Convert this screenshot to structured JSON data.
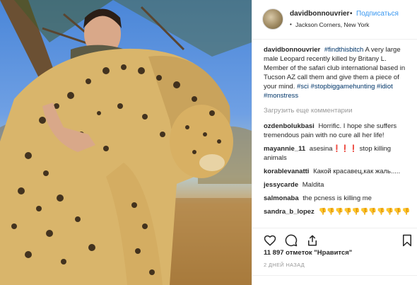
{
  "header": {
    "username": "davidbonnouvrier",
    "dot": "•",
    "follow": "Подписаться",
    "location_dot": "•",
    "location": "Jackson Corners, New York"
  },
  "caption": {
    "username": "davidbonnouvrier",
    "hashtag_1": "#findthisbitch",
    "text": "A very large male Leopard recently killed by Britany L. Member of the safari club international based in Tucson AZ call them and give them a piece of your mind.",
    "hashtag_2": "#sci",
    "hashtag_3": "#stopbiggamehunting",
    "hashtag_4": "#idiot",
    "hashtag_5": "#monstress"
  },
  "load_more": "Загрузить еще комментарии",
  "comments": [
    {
      "user": "ozdenbolukbasi",
      "text": "Horrific. I hope she suffers tremendous pain with no cure all her life!"
    },
    {
      "user": "mayannie_11",
      "text": "asesina❗❗❗ stop killing animals"
    },
    {
      "user": "korablevanatti",
      "text": "Какой красавец,как жаль....."
    },
    {
      "user": "jessycarde",
      "text": "Maldita"
    },
    {
      "user": "salmonaba",
      "text": "the pcness is killing me"
    },
    {
      "user": "sandra_b_lopez",
      "text": "👎👎👎👎👎👎👎👎👎👎👎"
    }
  ],
  "likes": "11 897 отметок \"Нравится\"",
  "time": "2 ДНЕЙ НАЗАД",
  "icons": {
    "like": "heart-icon",
    "comment": "comment-icon",
    "share": "share-icon",
    "save": "bookmark-icon"
  },
  "colors": {
    "link": "#3897f0",
    "hashtag": "#003569",
    "muted": "#999999",
    "text": "#262626"
  }
}
